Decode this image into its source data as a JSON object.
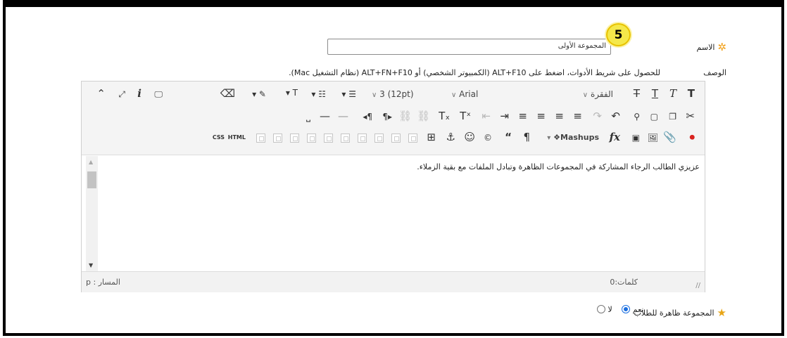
{
  "form": {
    "name_label": "الاسم",
    "name_value": "المجموعة الأولى",
    "description_label": "الوصف",
    "toolbar_hint": "للحصول على شريط الأدوات، اضغط على ALT+F10 (الكمبيوتر الشخصي) أو ALT+FN+F10 (نظام التشغيل Mac).",
    "visible_label": "المجموعة ظاهرة للطلاب",
    "visible_yes": "نعم",
    "visible_no": "لا",
    "visible_selected": "نعم",
    "required_color": "#f2a21d"
  },
  "callout": {
    "step": "5",
    "color": "#f5e84a"
  },
  "editor": {
    "paragraph_select": "الفقرة",
    "font_select": "Arial",
    "size_select": "3 (12pt)",
    "mashups": "Mashups",
    "css_label": "CSS",
    "html_label": "HTML",
    "content": "عزيزي الطالب الرجاء المشاركة في المجموعات الظاهرة وتبادل الملفات مع بقية الزملاء.",
    "path_label": "المسار",
    "path_value": "p",
    "words_label": "كلمات",
    "words_value": "0"
  },
  "icons": {
    "row1": [
      "bold-icon",
      "italic-icon",
      "underline-icon",
      "strikethrough-icon",
      "paragraph-dropdown",
      "font-dropdown",
      "size-dropdown",
      "bullet-list-icon",
      "numbered-list-icon",
      "text-color-icon",
      "highlight-icon",
      "eraser-icon",
      "preview-icon",
      "info-icon",
      "fullscreen-icon",
      "collapse-icon"
    ],
    "row2": [
      "cut-icon",
      "copy-icon",
      "paste-icon",
      "find-icon",
      "undo-icon",
      "redo-icon",
      "align-right-icon",
      "align-center-icon",
      "align-left-icon",
      "justify-icon",
      "indent-icon",
      "outdent-icon",
      "superscript-icon",
      "subscript-icon",
      "link-icon",
      "unlink-icon",
      "ltr-icon",
      "rtl-icon",
      "horizontal-rule-icon",
      "hr-icon",
      "nonbreaking-space-icon"
    ],
    "row3": [
      "youtube-icon",
      "attach-icon",
      "image-icon",
      "media-icon",
      "math-icon",
      "mashups-icon",
      "pilcrow-icon",
      "quote-icon",
      "copyright-icon",
      "emoticon-icon",
      "anchor-icon",
      "table-icon",
      "html-icon",
      "css-icon"
    ]
  }
}
